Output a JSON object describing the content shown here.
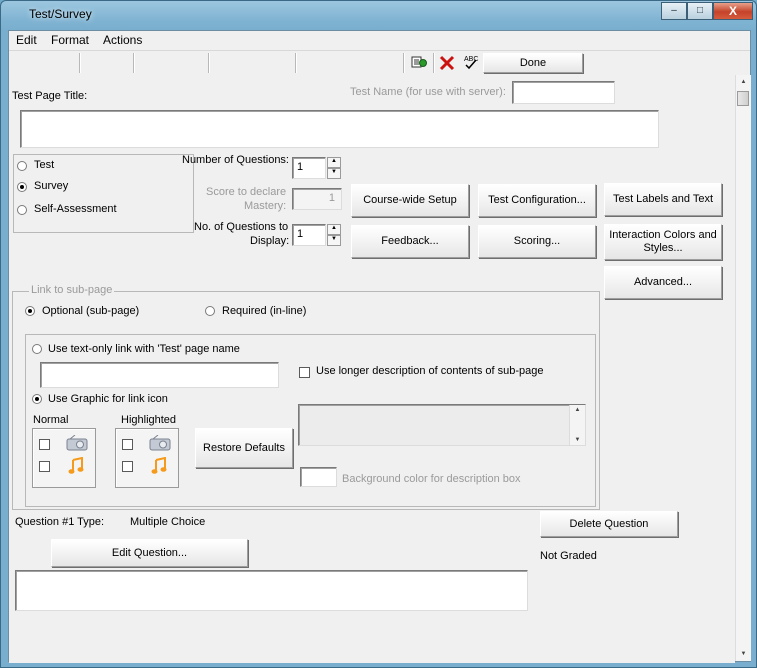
{
  "window": {
    "title": "Test/Survey",
    "minimize": "–",
    "maximize": "□",
    "close": "X"
  },
  "menu": [
    "Edit",
    "Format",
    "Actions"
  ],
  "toolbar": {
    "done_label": "Done",
    "icons": [
      "toc-icon",
      "delete-x-icon",
      "spellcheck-icon"
    ]
  },
  "page_title": {
    "label": "Test Page Title:",
    "value": ""
  },
  "test_name": {
    "label": "Test Name (for use with server):",
    "value": ""
  },
  "type_options": {
    "items": [
      "Test",
      "Survey",
      "Self-Assessment"
    ],
    "selected": "Survey"
  },
  "num_questions": {
    "label": "Number of Questions:",
    "value": "1"
  },
  "mastery": {
    "label_1": "Score to declare",
    "label_2": "Mastery:",
    "value": "1"
  },
  "display_questions": {
    "label_1": "No. of Questions to",
    "label_2": "Display:",
    "value": "1"
  },
  "buttons": {
    "course_wide": "Course-wide Setup",
    "test_config": "Test Configuration...",
    "test_labels": "Test Labels and Text",
    "feedback": "Feedback...",
    "scoring": "Scoring...",
    "interaction_colors_1": "Interaction Colors and",
    "interaction_colors_2": "Styles...",
    "advanced": "Advanced...",
    "restore_defaults": "Restore Defaults",
    "delete_question": "Delete Question",
    "edit_question": "Edit Question..."
  },
  "link": {
    "group_label": "Link to sub-page",
    "optional": "Optional (sub-page)",
    "required": "Required (in-line)",
    "text_only": "Use text-only link with 'Test' page name",
    "graphic": "Use Graphic for link icon",
    "longer_desc": "Use longer description of contents of sub-page",
    "normal": "Normal",
    "highlighted": "Highlighted",
    "bg_color": "Background color for description box",
    "selected_mode": "Optional (sub-page)",
    "selected_link": "Use Graphic for link icon"
  },
  "question": {
    "type_label": "Question #1 Type:",
    "type_value": "Multiple Choice",
    "graded": "Not Graded"
  },
  "colors": {
    "chrome": "#f0f0f0",
    "titlebar": "#7fb3d2",
    "close": "#c4432a",
    "delete_red": "#cc1111",
    "music_orange": "#f59a1a"
  }
}
